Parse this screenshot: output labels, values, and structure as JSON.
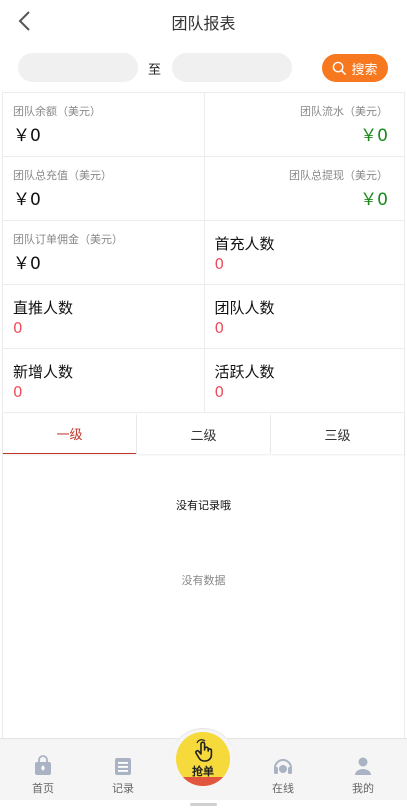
{
  "header": {
    "title": "团队报表",
    "back_icon": "chevron-left-icon"
  },
  "search": {
    "start_value": "",
    "end_value": "",
    "to_label": "至",
    "button_label": "搜索",
    "button_color": "#f7781f"
  },
  "stats": {
    "team_balance": {
      "label": "团队余额（美元）",
      "value": "￥0"
    },
    "team_flow": {
      "label": "团队流水（美元）",
      "value": "￥0"
    },
    "team_recharge": {
      "label": "团队总充值（美元）",
      "value": "￥0"
    },
    "team_withdraw": {
      "label": "团队总提现（美元）",
      "value": "￥0"
    },
    "team_commission": {
      "label": "团队订单佣金（美元）",
      "value": "￥0"
    },
    "first_recharge": {
      "label": "首充人数",
      "value": "0"
    },
    "direct": {
      "label": "直推人数",
      "value": "0"
    },
    "team_count": {
      "label": "团队人数",
      "value": "0"
    },
    "new_count": {
      "label": "新增人数",
      "value": "0"
    },
    "active_count": {
      "label": "活跃人数",
      "value": "0"
    }
  },
  "tabs": [
    {
      "label": "一级",
      "active": true
    },
    {
      "label": "二级",
      "active": false
    },
    {
      "label": "三级",
      "active": false
    }
  ],
  "empty": {
    "no_record": "没有记录哦",
    "no_data": "没有数据"
  },
  "nav": {
    "home": "首页",
    "record": "记录",
    "grab": "抢单",
    "online": "在线",
    "mine": "我的"
  },
  "colors": {
    "accent": "#f7781f",
    "positive": "#1b8a1b",
    "count": "#f04d5a",
    "tab_active": "#c0392b"
  }
}
